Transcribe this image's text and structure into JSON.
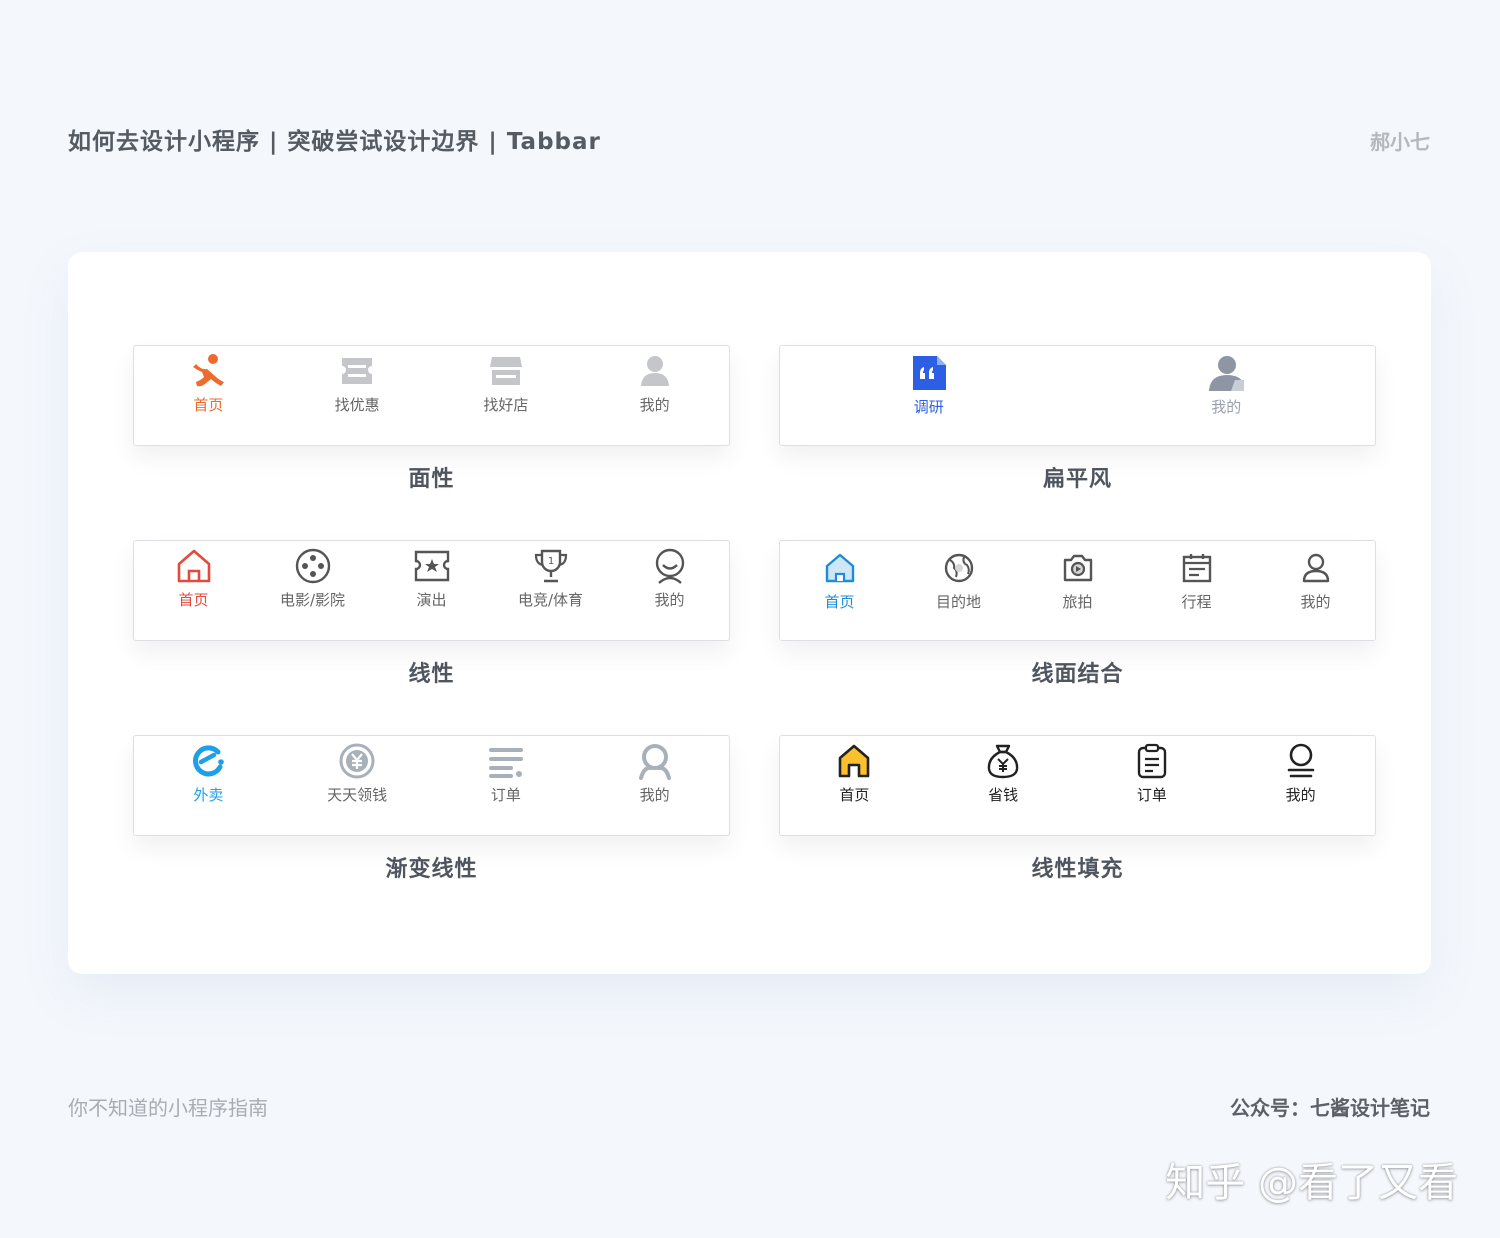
{
  "header": {
    "title": "如何去设计小程序 | 突破尝试设计边界 | Tabbar",
    "author": "郝小七"
  },
  "panels": [
    {
      "caption": "面性",
      "tabs": [
        {
          "label": "首页",
          "icon": "person-icon",
          "color": "#ee6b2f",
          "active": true
        },
        {
          "label": "找优惠",
          "icon": "ticket-icon",
          "color": "#666666"
        },
        {
          "label": "找好店",
          "icon": "shop-icon",
          "color": "#666666"
        },
        {
          "label": "我的",
          "icon": "user-icon",
          "color": "#666666"
        }
      ]
    },
    {
      "caption": "扁平风",
      "tabs": [
        {
          "label": "调研",
          "icon": "document-quote-icon",
          "color": "#2c5fe4",
          "active": true
        },
        {
          "label": "我的",
          "icon": "user-icon",
          "color": "#9aa1ad"
        }
      ]
    },
    {
      "caption": "线性",
      "tabs": [
        {
          "label": "首页",
          "icon": "home-icon",
          "color": "#e24a3b",
          "active": true
        },
        {
          "label": "电影/影院",
          "icon": "film-reel-icon",
          "color": "#666666"
        },
        {
          "label": "演出",
          "icon": "star-ticket-icon",
          "color": "#666666"
        },
        {
          "label": "电竞/体育",
          "icon": "trophy-icon",
          "color": "#666666"
        },
        {
          "label": "我的",
          "icon": "smile-face-icon",
          "color": "#666666"
        }
      ]
    },
    {
      "caption": "线面结合",
      "tabs": [
        {
          "label": "首页",
          "icon": "home-icon",
          "color": "#1b8ed6",
          "active": true
        },
        {
          "label": "目的地",
          "icon": "globe-icon",
          "color": "#666666"
        },
        {
          "label": "旅拍",
          "icon": "camera-icon",
          "color": "#666666"
        },
        {
          "label": "行程",
          "icon": "calendar-icon",
          "color": "#666666"
        },
        {
          "label": "我的",
          "icon": "user-outline-icon",
          "color": "#666666"
        }
      ]
    },
    {
      "caption": "渐变线性",
      "tabs": [
        {
          "label": "外卖",
          "icon": "eleme-logo-icon",
          "color": "#1e9fe8",
          "active": true
        },
        {
          "label": "天天领钱",
          "icon": "yen-coin-icon",
          "color": "#666666"
        },
        {
          "label": "订单",
          "icon": "list-icon",
          "color": "#666666"
        },
        {
          "label": "我的",
          "icon": "user-outline-icon",
          "color": "#666666"
        }
      ]
    },
    {
      "caption": "线性填充",
      "tabs": [
        {
          "label": "首页",
          "icon": "home-filled-icon",
          "color": "#222222",
          "active": true
        },
        {
          "label": "省钱",
          "icon": "money-bag-icon",
          "color": "#222222"
        },
        {
          "label": "订单",
          "icon": "clipboard-icon",
          "color": "#222222"
        },
        {
          "label": "我的",
          "icon": "user-outline-icon",
          "color": "#222222"
        }
      ]
    }
  ],
  "footer": {
    "left": "你不知道的小程序指南",
    "right": "公众号：七酱设计笔记",
    "watermark": "知乎 @看了又看"
  }
}
